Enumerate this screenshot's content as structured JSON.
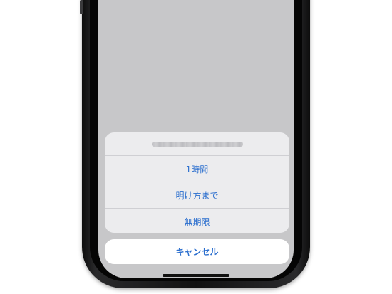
{
  "action_sheet": {
    "options": [
      {
        "label": "1時間"
      },
      {
        "label": "明け方まで"
      },
      {
        "label": "無期限"
      }
    ],
    "cancel_label": "キャンセル"
  },
  "colors": {
    "accent": "#2c6fce",
    "sheet_background": "#ececee",
    "screen_background": "#c7c7c9",
    "phone_frame": "#111111"
  }
}
